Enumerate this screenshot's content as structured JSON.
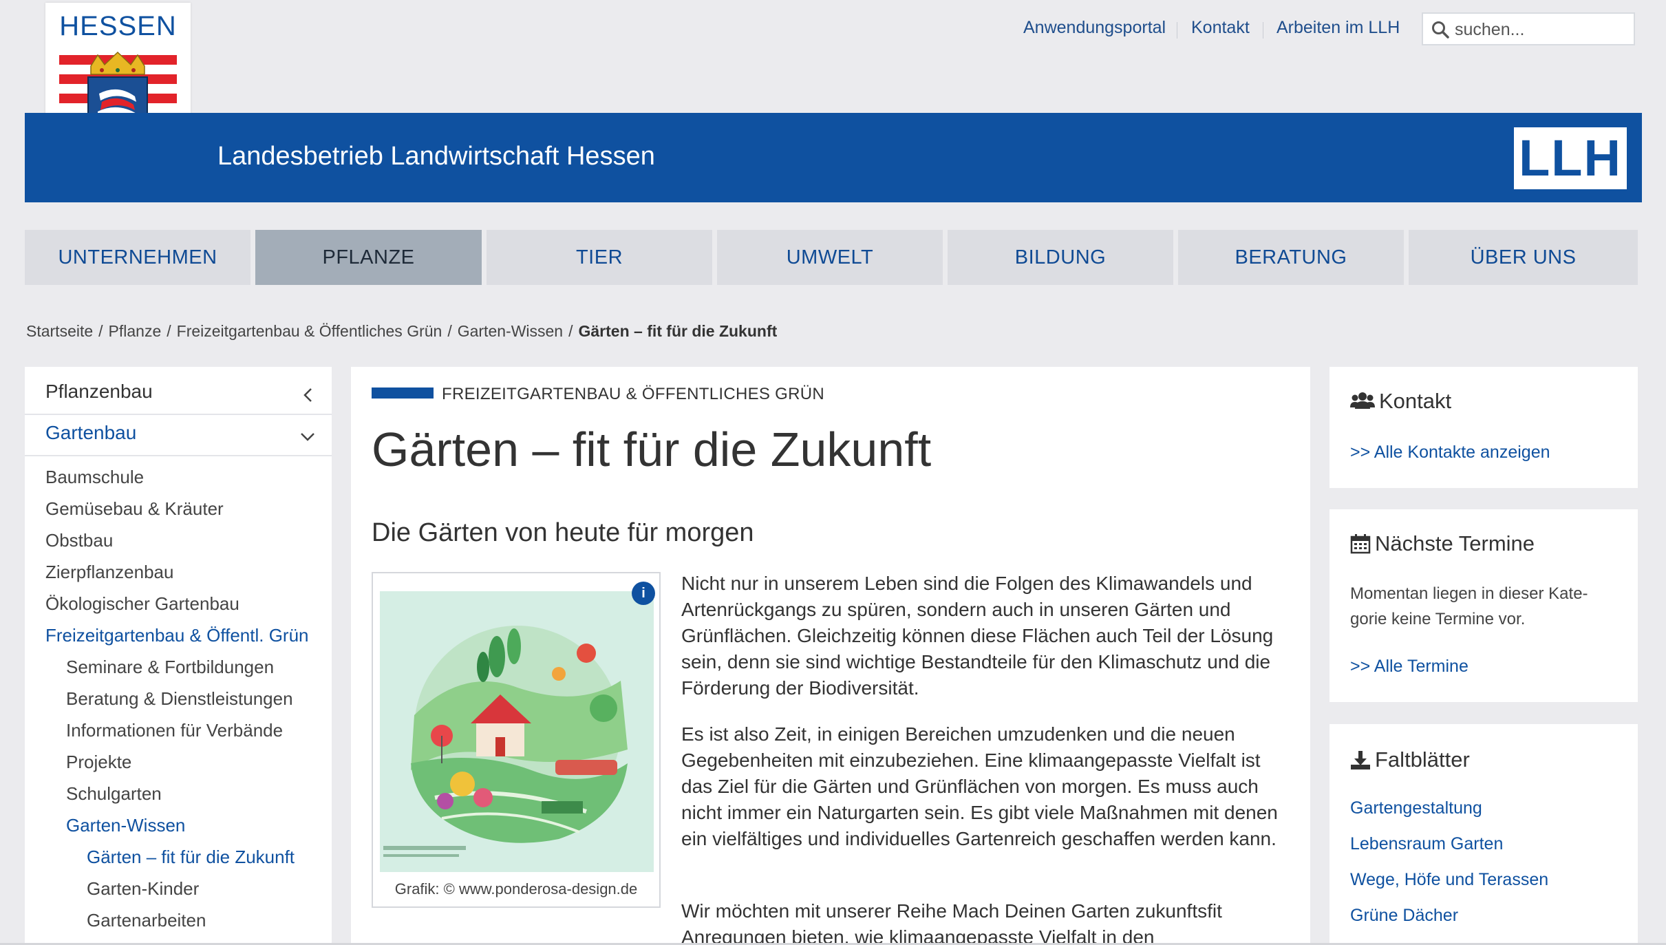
{
  "header": {
    "state_name": "HESSEN",
    "org_name": "Landesbetrieb Landwirtschaft Hessen",
    "logo_text": "LLH",
    "top_links": [
      "Anwendungsportal",
      "Kontakt",
      "Arbeiten im LLH"
    ],
    "search_placeholder": "suchen..."
  },
  "nav": {
    "items": [
      "UNTERNEHMEN",
      "PFLANZE",
      "TIER",
      "UMWELT",
      "BILDUNG",
      "BERATUNG",
      "ÜBER UNS"
    ],
    "active": "PFLANZE"
  },
  "breadcrumb": {
    "items": [
      "Startseite",
      "Pflanze",
      "Freizeitgartenbau & Öffentliches Grün",
      "Garten-Wissen"
    ],
    "current": "Gärten – fit für die Zukunft",
    "separator": "/"
  },
  "sidebar": {
    "section1": "Pflanzenbau",
    "section2": "Gartenbau",
    "items": [
      "Baumschule",
      "Gemüsebau & Kräuter",
      "Obstbau",
      "Zierpflanzenbau",
      "Ökologischer Gartenbau",
      "Freizeitgartenbau & Öffentl. Grün",
      "Seminare & Fortbildungen",
      "Beratung & Dienstleistungen",
      "Informationen für Verbände",
      "Projekte",
      "Schulgarten",
      "Garten-Wissen",
      "Gärten – fit für die Zukunft",
      "Garten-Kinder",
      "Gartenarbeiten"
    ]
  },
  "article": {
    "kicker": "FREIZEITGARTENBAU & ÖFFENTLICHES GRÜN",
    "title": "Gärten – fit für die Zukunft",
    "subtitle": "Die Gärten von heute für morgen",
    "figure_caption": "Grafik: © www.ponderosa-design.de",
    "figure_info": "i",
    "paragraphs": [
      "Nicht nur in unserem Leben sind die Folgen des Klimawandels und Artenrückgangs zu spüren, sondern auch in unseren Gärten und Grünflächen. Gleichzeitig können diese Flächen auch Teil der Lösung sein, denn sie sind wichtige Bestandteile für den Klimaschutz und die Förderung der Biodiversität.",
      "Es ist also Zeit, in einigen Bereichen umzudenken und die neuen Gegebenheiten mit einzubeziehen. Eine klimaangepasste Vielfalt ist das Ziel für die Gärten und Grünflächen von morgen. Es muss auch nicht immer ein Naturgarten sein. Es gibt viele Maßnahmen mit denen ein vielfältiges und individuelles Gartenreich geschaffen werden kann.",
      "Wir möchten mit unserer Reihe Mach Deinen Garten zukunftsfit Anregungen bieten, wie klimaangepasste Vielfalt in den"
    ]
  },
  "aside": {
    "contact": {
      "title": "Kontakt",
      "link": ">> Alle Kontakte anzeigen"
    },
    "events": {
      "title": "Nächste Termine",
      "text": "Momentan liegen in dieser Kate- gorie keine Termine vor.",
      "link": ">> Alle Termine"
    },
    "leaflets": {
      "title": "Faltblätter",
      "links": [
        "Gartengestaltung",
        "Lebensraum Garten",
        "Wege, Höfe und Terassen",
        "Grüne Dächer"
      ]
    }
  },
  "colors": {
    "brand_blue": "#0f51a0",
    "page_bg": "#ebebee",
    "nav_bg": "#dcdde2",
    "nav_active_bg": "#a3adb8",
    "hessen_red": "#e2232a"
  }
}
